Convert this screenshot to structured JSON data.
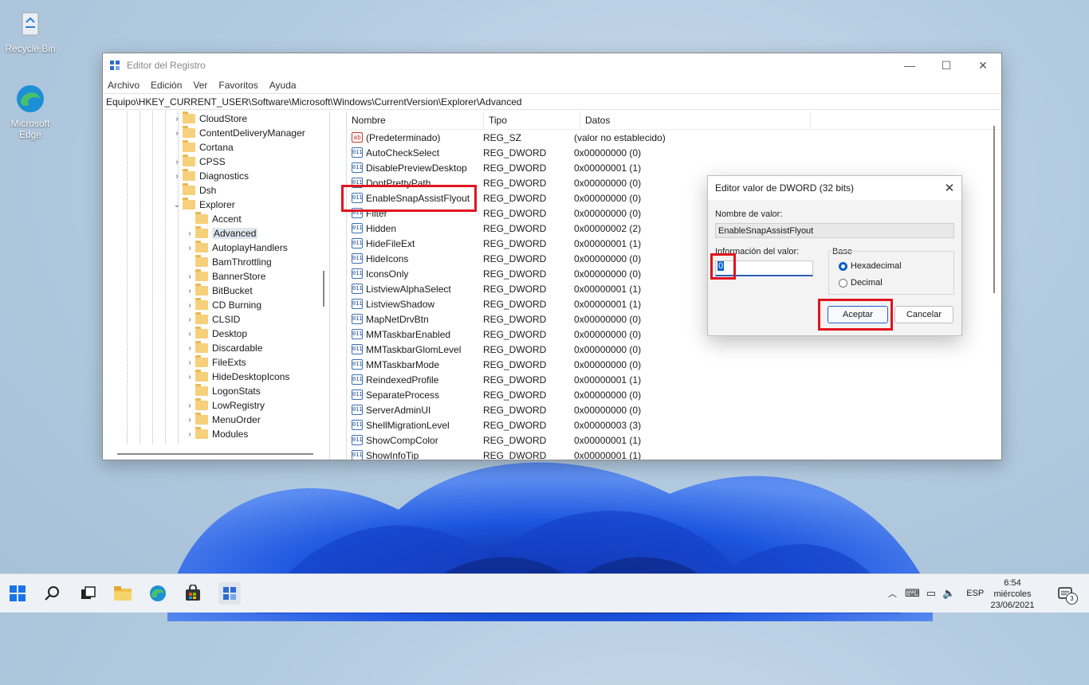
{
  "desktop": {
    "icons": [
      {
        "label": "Recycle Bin"
      },
      {
        "label": "Microsoft Edge"
      }
    ]
  },
  "window": {
    "title": "Editor del Registro",
    "menu": [
      "Archivo",
      "Edición",
      "Ver",
      "Favoritos",
      "Ayuda"
    ],
    "address": "Equipo\\HKEY_CURRENT_USER\\Software\\Microsoft\\Windows\\CurrentVersion\\Explorer\\Advanced"
  },
  "tree": {
    "items": [
      {
        "label": "CloudStore"
      },
      {
        "label": "ContentDeliveryManager"
      },
      {
        "label": "Cortana"
      },
      {
        "label": "CPSS"
      },
      {
        "label": "Diagnostics"
      },
      {
        "label": "Dsh"
      },
      {
        "label": "Explorer"
      },
      {
        "label": "Accent"
      },
      {
        "label": "Advanced"
      },
      {
        "label": "AutoplayHandlers"
      },
      {
        "label": "BamThrottling"
      },
      {
        "label": "BannerStore"
      },
      {
        "label": "BitBucket"
      },
      {
        "label": "CD Burning"
      },
      {
        "label": "CLSID"
      },
      {
        "label": "Desktop"
      },
      {
        "label": "Discardable"
      },
      {
        "label": "FileExts"
      },
      {
        "label": "HideDesktopIcons"
      },
      {
        "label": "LogonStats"
      },
      {
        "label": "LowRegistry"
      },
      {
        "label": "MenuOrder"
      },
      {
        "label": "Modules"
      }
    ]
  },
  "list": {
    "headers": {
      "name": "Nombre",
      "type": "Tipo",
      "data": "Datos"
    },
    "rows": [
      {
        "name": "(Predeterminado)",
        "type": "REG_SZ",
        "data": "(valor no establecido)",
        "icon": "string-value-icon"
      },
      {
        "name": "AutoCheckSelect",
        "type": "REG_DWORD",
        "data": "0x00000000 (0)"
      },
      {
        "name": "DisablePreviewDesktop",
        "type": "REG_DWORD",
        "data": "0x00000001 (1)"
      },
      {
        "name": "DontPrettyPath",
        "type": "REG_DWORD",
        "data": "0x00000000 (0)"
      },
      {
        "name": "EnableSnapAssistFlyout",
        "type": "REG_DWORD",
        "data": "0x00000000 (0)"
      },
      {
        "name": "Filter",
        "type": "REG_DWORD",
        "data": "0x00000000 (0)"
      },
      {
        "name": "Hidden",
        "type": "REG_DWORD",
        "data": "0x00000002 (2)"
      },
      {
        "name": "HideFileExt",
        "type": "REG_DWORD",
        "data": "0x00000001 (1)"
      },
      {
        "name": "HideIcons",
        "type": "REG_DWORD",
        "data": "0x00000000 (0)"
      },
      {
        "name": "IconsOnly",
        "type": "REG_DWORD",
        "data": "0x00000000 (0)"
      },
      {
        "name": "ListviewAlphaSelect",
        "type": "REG_DWORD",
        "data": "0x00000001 (1)"
      },
      {
        "name": "ListviewShadow",
        "type": "REG_DWORD",
        "data": "0x00000001 (1)"
      },
      {
        "name": "MapNetDrvBtn",
        "type": "REG_DWORD",
        "data": "0x00000000 (0)"
      },
      {
        "name": "MMTaskbarEnabled",
        "type": "REG_DWORD",
        "data": "0x00000000 (0)"
      },
      {
        "name": "MMTaskbarGlomLevel",
        "type": "REG_DWORD",
        "data": "0x00000000 (0)"
      },
      {
        "name": "MMTaskbarMode",
        "type": "REG_DWORD",
        "data": "0x00000000 (0)"
      },
      {
        "name": "ReindexedProfile",
        "type": "REG_DWORD",
        "data": "0x00000001 (1)"
      },
      {
        "name": "SeparateProcess",
        "type": "REG_DWORD",
        "data": "0x00000000 (0)"
      },
      {
        "name": "ServerAdminUI",
        "type": "REG_DWORD",
        "data": "0x00000000 (0)"
      },
      {
        "name": "ShellMigrationLevel",
        "type": "REG_DWORD",
        "data": "0x00000003 (3)"
      },
      {
        "name": "ShowCompColor",
        "type": "REG_DWORD",
        "data": "0x00000001 (1)"
      },
      {
        "name": "ShowInfoTip",
        "type": "REG_DWORD",
        "data": "0x00000001 (1)"
      }
    ]
  },
  "dialog": {
    "title": "Editor valor de DWORD (32 bits)",
    "value_name_label": "Nombre de valor:",
    "value_name": "EnableSnapAssistFlyout",
    "value_data_label": "Información del valor:",
    "value_data": "0",
    "base_label": "Base",
    "base_hex": "Hexadecimal",
    "base_dec": "Decimal",
    "ok": "Aceptar",
    "cancel": "Cancelar"
  },
  "taskbar": {
    "language": "ESP",
    "time": "6:54",
    "day": "miércoles",
    "date": "23/06/2021",
    "notifications": "3"
  },
  "colors": {
    "highlight": "#e0141e",
    "accent": "#0a5bc7"
  }
}
